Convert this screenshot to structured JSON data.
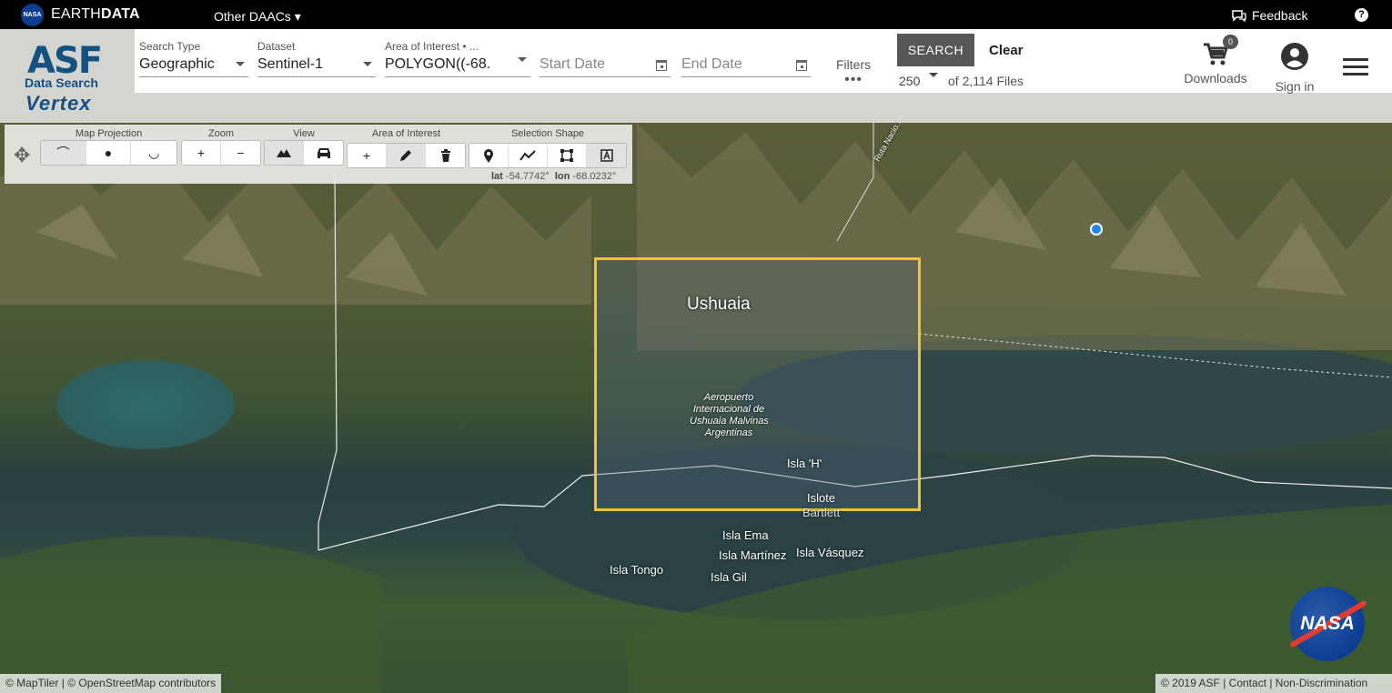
{
  "topbar": {
    "nasa_badge": "NASA",
    "earthdata_prefix": "EARTH",
    "earthdata_suffix": "DATA",
    "other_daacs": "Other DAACs ▾",
    "feedback": "Feedback",
    "help": "?"
  },
  "logo": {
    "asf": "ASF",
    "data_search": "Data Search",
    "vertex": "Vertex"
  },
  "search": {
    "search_type_label": "Search Type",
    "search_type_value": "Geographic",
    "dataset_label": "Dataset",
    "dataset_value": "Sentinel-1",
    "aoi_label": "Area of Interest • ...",
    "aoi_value": "POLYGON((-68.",
    "start_date_placeholder": "Start Date",
    "end_date_placeholder": "End Date",
    "filters_label": "Filters",
    "filters_dots": "•••",
    "search_button": "SEARCH",
    "clear_button": "Clear",
    "max_results": "250",
    "files_count": "of 2,114 Files"
  },
  "nav": {
    "downloads": "Downloads",
    "downloads_badge": "0",
    "sign_in": "Sign in"
  },
  "toolbar": {
    "map_projection": "Map Projection",
    "zoom": "Zoom",
    "view": "View",
    "area_of_interest": "Area of Interest",
    "selection_shape": "Selection Shape",
    "zoom_in": "+",
    "zoom_out": "−",
    "aoi_add": "+",
    "lat_label": "lat",
    "lat_value": "-54.7742°",
    "lon_label": "lon",
    "lon_value": "-68.0232°"
  },
  "map_labels": {
    "ushuaia": "Ushuaia",
    "airport_1": "Aeropuerto",
    "airport_2": "Internacional de",
    "airport_3": "Ushuaia Malvinas",
    "airport_4": "Argentinas",
    "isla_h": "Isla 'H'",
    "islote": "Islote",
    "bartlett": "Bartlett",
    "isla_ema": "Isla Ema",
    "isla_martinez": "Isla Martínez",
    "isla_vasquez": "Isla Vásquez",
    "isla_tongo": "Isla Tongo",
    "isla_gil": "Isla Gil",
    "ruta": "Ruta Nacio..."
  },
  "footer": {
    "credits_left": "© MapTiler | © OpenStreetMap contributors",
    "credits_right": "© 2019 ASF  | Contact  | Non-Discrimination",
    "nasa_logo": "NASA"
  },
  "colors": {
    "aoi_outline": "#f5c22b",
    "search_button": "#575757",
    "asf_blue": "#15507f",
    "pin": "#1e88e5"
  }
}
